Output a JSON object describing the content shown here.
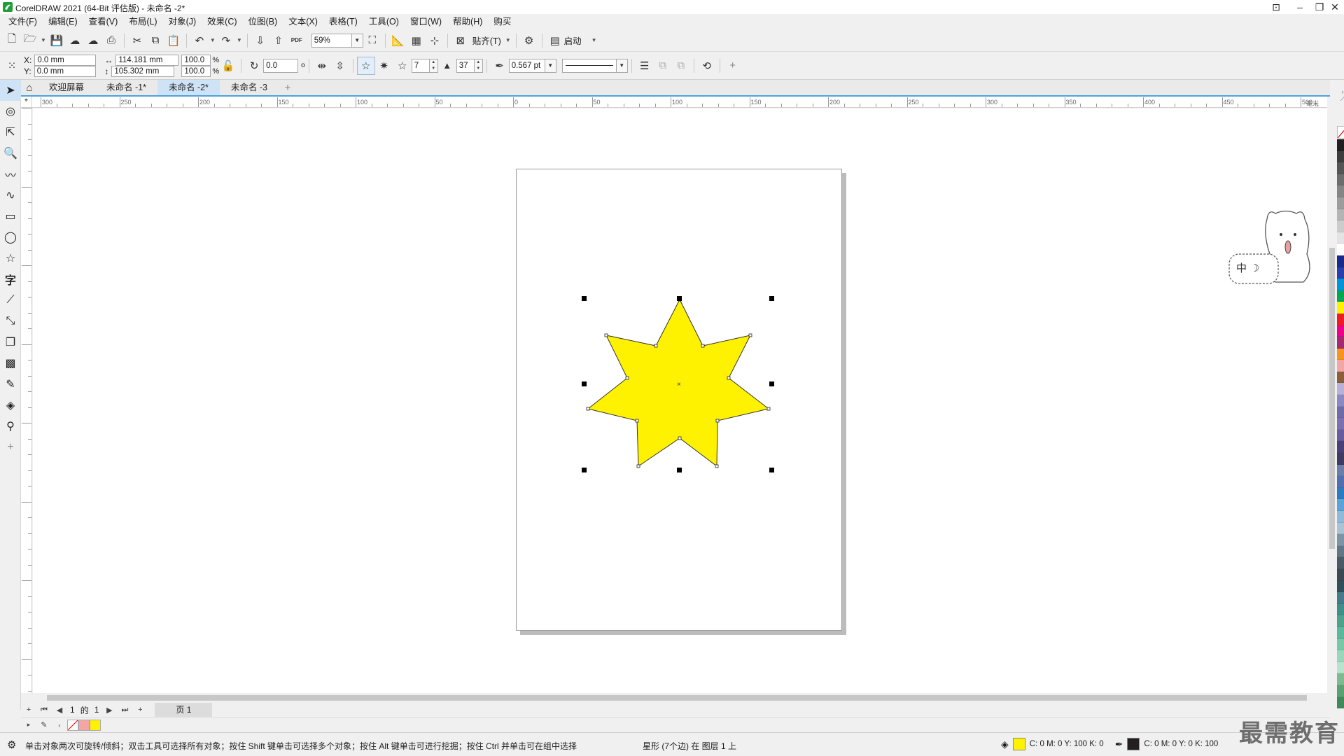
{
  "window": {
    "title": "CorelDRAW 2021 (64-Bit 评估版) - 未命名 -2*",
    "controls": {
      "minimize": "–",
      "restore": "❐",
      "close": "✕"
    }
  },
  "menu": [
    "文件(F)",
    "编辑(E)",
    "查看(V)",
    "布局(L)",
    "对象(J)",
    "效果(C)",
    "位图(B)",
    "文本(X)",
    "表格(T)",
    "工具(O)",
    "窗口(W)",
    "帮助(H)",
    "购买"
  ],
  "standard_toolbar": {
    "zoom": "59%",
    "snap_label": "贴齐(T)",
    "launch_label": "启动",
    "pdf_label": "PDF"
  },
  "property_bar": {
    "x_label": "X:",
    "y_label": "Y:",
    "x": "0.0 mm",
    "y": "0.0 mm",
    "width": "114.181 mm",
    "height": "105.302 mm",
    "scale_w": "100.0",
    "scale_h": "100.0",
    "percent": "%",
    "rotation": "0.0",
    "degree_symbol": "o",
    "points": "7",
    "sharpness": "37",
    "outline_width": "0.567 pt"
  },
  "tabs": [
    {
      "label": "欢迎屏幕",
      "active": false
    },
    {
      "label": "未命名 -1*",
      "active": false
    },
    {
      "label": "未命名 -2*",
      "active": true
    },
    {
      "label": "未命名 -3",
      "active": false
    }
  ],
  "ruler": {
    "h_ticks": [
      "300",
      "250",
      "200",
      "150",
      "100",
      "50",
      "0",
      "50",
      "100",
      "150",
      "200",
      "250",
      "300",
      "350",
      "400",
      "450",
      "500"
    ],
    "unit": "毫米"
  },
  "page_nav": {
    "current": "1",
    "of": "的",
    "total": "1",
    "page_tab": "页 1"
  },
  "status": {
    "hint": "单击对象两次可旋转/倾斜；双击工具可选择所有对象；按住 Shift 键单击可选择多个对象；按住 Alt 键单击可进行挖掘；按住 Ctrl 并单击可在组中选择",
    "object_info": "星形 (7个边) 在 图层 1 上",
    "fill_cmyk": "C: 0 M: 0 Y: 100 K: 0",
    "outline_cmyk": "C: 0 M: 0 Y: 0 K: 100"
  },
  "mascot_text": "中 ☽",
  "watermark": "最需教育",
  "colors": {
    "accent": "#4aa3df",
    "star_fill": "#fff200",
    "star_stroke": "#333333",
    "tab_active": "#cfe3f7",
    "doc_palette": [
      "#f4a6a6",
      "#fff200"
    ]
  },
  "palette_colors": [
    "#231f20",
    "#3d3d3d",
    "#555555",
    "#6d6d6d",
    "#858585",
    "#9c9c9c",
    "#b4b4b4",
    "#cccccc",
    "#e3e3e3",
    "#ffffff",
    "#1b2a8a",
    "#2a3fae",
    "#0093d8",
    "#00a651",
    "#fff200",
    "#ed1c24",
    "#ec008c",
    "#a4296e",
    "#f7941d",
    "#f4a6a6",
    "#8b5e3c",
    "#b8b1d9",
    "#8c89c2",
    "#6f6aa8",
    "#7d6fb0",
    "#6a5a9e",
    "#4b3f7a",
    "#3f3a62",
    "#6a7ea8",
    "#4f6fb0",
    "#2b7bc0",
    "#5aa3d6",
    "#8fb9d9",
    "#a9c2d4",
    "#7d94a4",
    "#5e7887",
    "#4a5b66",
    "#3b4a52",
    "#2f4f5a",
    "#447a8a",
    "#3e8f8a",
    "#4aa38a",
    "#5cb89a",
    "#78c8a8",
    "#9ad6bb",
    "#b8e2cc",
    "#7fb98f",
    "#5aa072",
    "#3f8a5a"
  ]
}
